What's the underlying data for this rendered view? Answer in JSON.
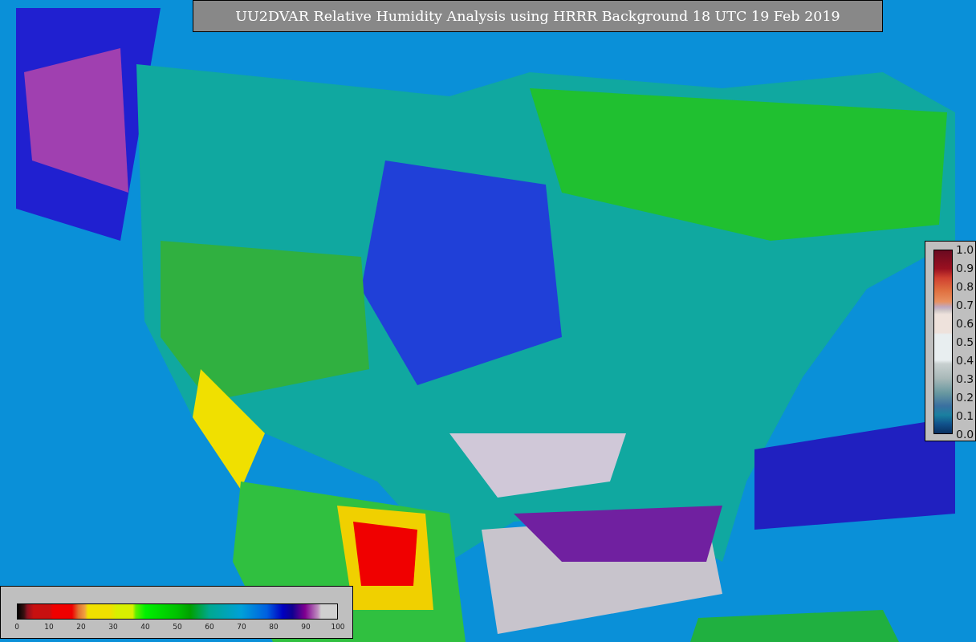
{
  "title": "UU2DVAR Relative Humidity Analysis using HRRR Background 18 UTC 19 Feb 2019",
  "legends": [
    {
      "kind": "horizontal",
      "ticks": [
        "0",
        "10",
        "20",
        "30",
        "40",
        "50",
        "60",
        "70",
        "80",
        "90",
        "100"
      ]
    },
    {
      "kind": "vertical",
      "ticks": [
        "1.0",
        "0.9",
        "0.8",
        "0.7",
        "0.6",
        "0.5",
        "0.4",
        "0.3",
        "0.2",
        "0.1",
        "0.0"
      ]
    }
  ]
}
